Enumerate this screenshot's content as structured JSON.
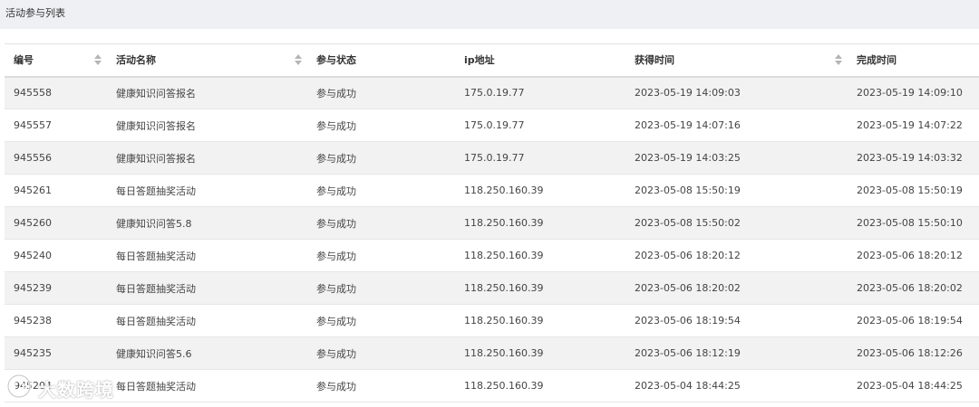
{
  "header": {
    "title": "活动参与列表"
  },
  "table": {
    "columns": [
      {
        "label": "编号",
        "sortable": true
      },
      {
        "label": "活动名称",
        "sortable": true
      },
      {
        "label": "参与状态",
        "sortable": false
      },
      {
        "label": "ip地址",
        "sortable": false
      },
      {
        "label": "获得时间",
        "sortable": true
      },
      {
        "label": "完成时间",
        "sortable": false
      }
    ],
    "rows": [
      [
        "945558",
        "健康知识问答报名",
        "参与成功",
        "175.0.19.77",
        "2023-05-19 14:09:03",
        "2023-05-19 14:09:10"
      ],
      [
        "945557",
        "健康知识问答报名",
        "参与成功",
        "175.0.19.77",
        "2023-05-19 14:07:16",
        "2023-05-19 14:07:22"
      ],
      [
        "945556",
        "健康知识问答报名",
        "参与成功",
        "175.0.19.77",
        "2023-05-19 14:03:25",
        "2023-05-19 14:03:32"
      ],
      [
        "945261",
        "每日答题抽奖活动",
        "参与成功",
        "118.250.160.39",
        "2023-05-08 15:50:19",
        "2023-05-08 15:50:19"
      ],
      [
        "945260",
        "健康知识问答5.8",
        "参与成功",
        "118.250.160.39",
        "2023-05-08 15:50:02",
        "2023-05-08 15:50:10"
      ],
      [
        "945240",
        "每日答题抽奖活动",
        "参与成功",
        "118.250.160.39",
        "2023-05-06 18:20:12",
        "2023-05-06 18:20:12"
      ],
      [
        "945239",
        "每日答题抽奖活动",
        "参与成功",
        "118.250.160.39",
        "2023-05-06 18:20:02",
        "2023-05-06 18:20:02"
      ],
      [
        "945238",
        "每日答题抽奖活动",
        "参与成功",
        "118.250.160.39",
        "2023-05-06 18:19:54",
        "2023-05-06 18:19:54"
      ],
      [
        "945235",
        "健康知识问答5.6",
        "参与成功",
        "118.250.160.39",
        "2023-05-06 18:12:19",
        "2023-05-06 18:12:26"
      ],
      [
        "945204",
        "每日答题抽奖活动",
        "参与成功",
        "118.250.160.39",
        "2023-05-04 18:44:25",
        "2023-05-04 18:44:25"
      ]
    ]
  },
  "watermark": {
    "text": "大数跨境"
  },
  "colors": {
    "title_bg": "#eef0f3",
    "row_alt": "#f2f2f2",
    "sort_icon": "#b5b5b5"
  },
  "icons": {
    "sort": "sort-arrows-icon",
    "watermark_logo": "watermark-logo-icon"
  }
}
